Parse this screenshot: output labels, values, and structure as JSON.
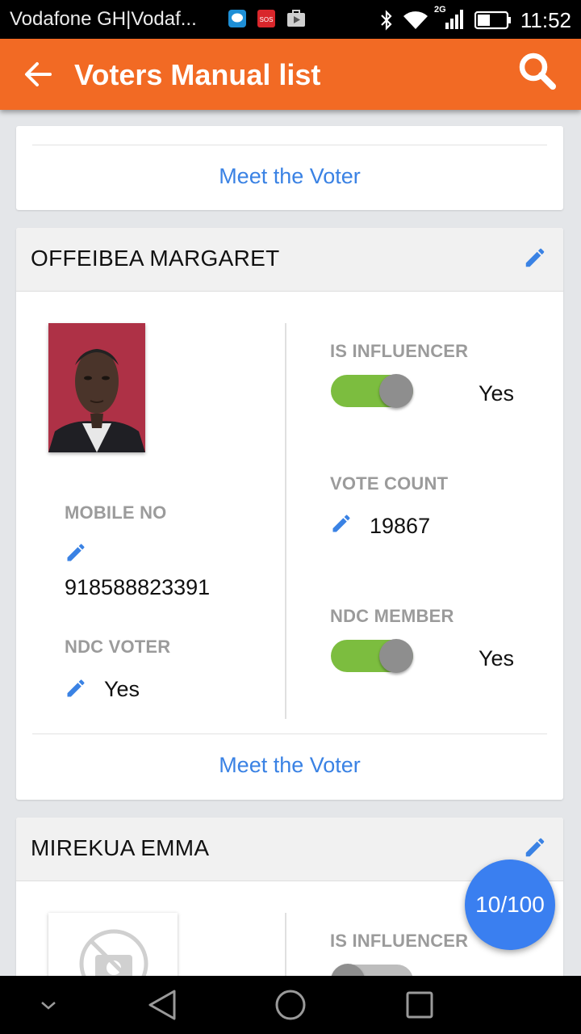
{
  "status_bar": {
    "carrier": "Vodafone GH|Vodaf...",
    "network": "2G",
    "time": "11:52"
  },
  "app_bar": {
    "title": "Voters Manual list"
  },
  "cards": [
    {
      "meet_label": "Meet the Voter"
    },
    {
      "name": "OFFEIBEA MARGARET",
      "mobile_label": "MOBILE NO",
      "mobile_value": "918588823391",
      "ndc_voter_label": "NDC VOTER",
      "ndc_voter_value": "Yes",
      "influencer_label": "IS INFLUENCER",
      "influencer_value": "Yes",
      "influencer_on": true,
      "vote_count_label": "VOTE COUNT",
      "vote_count_value": "19867",
      "ndc_member_label": "NDC MEMBER",
      "ndc_member_value": "Yes",
      "ndc_member_on": true,
      "meet_label": "Meet the Voter"
    },
    {
      "name": "MIREKUA EMMA",
      "influencer_label": "IS INFLUENCER",
      "influencer_on": false
    }
  ],
  "pagination": {
    "label": "10/100"
  },
  "colors": {
    "accent": "#f26a24",
    "link": "#3a82e4",
    "toggle_on": "#7cbd3f",
    "fab": "#3a7ff0"
  }
}
